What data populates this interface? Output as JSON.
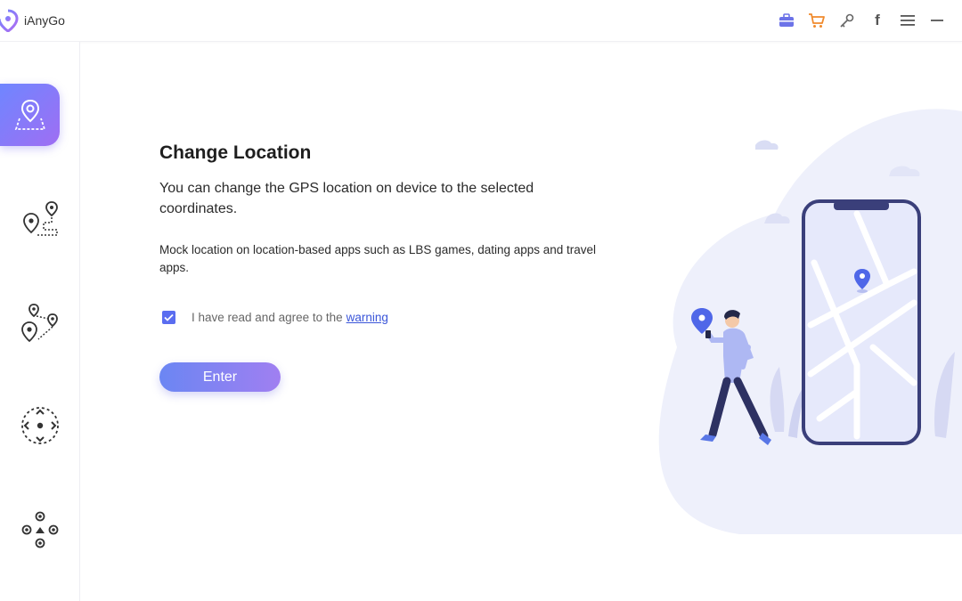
{
  "app": {
    "name": "iAnyGo"
  },
  "toolbar": {
    "icons": [
      "toolbox-icon",
      "cart-icon",
      "key-icon",
      "facebook-icon",
      "menu-icon",
      "minimize-icon"
    ],
    "facebook_glyph": "f"
  },
  "sidebar": {
    "items": [
      {
        "name": "change-location",
        "icon": "location-map-icon",
        "active": true
      },
      {
        "name": "two-spot-movement",
        "icon": "two-spot-route-icon",
        "active": false
      },
      {
        "name": "multi-spot-movement",
        "icon": "multi-spot-route-icon",
        "active": false
      },
      {
        "name": "joystick-movement",
        "icon": "joystick-icon",
        "active": false
      },
      {
        "name": "teleport-control",
        "icon": "direction-control-icon",
        "active": false
      }
    ]
  },
  "main": {
    "title": "Change Location",
    "description": "You can change the GPS location on device to the selected coordinates.",
    "subtext": "Mock location on location-based apps such as LBS games, dating apps and travel apps.",
    "agree_text": "I have read and agree to the",
    "warning_link": "warning",
    "agree_checked": true,
    "enter_label": "Enter"
  },
  "colors": {
    "accent_start": "#6f86ff",
    "accent_end": "#a07ff1",
    "checkbox": "#5a6df0",
    "link": "#3b56d9",
    "cart": "#f08a2c"
  }
}
